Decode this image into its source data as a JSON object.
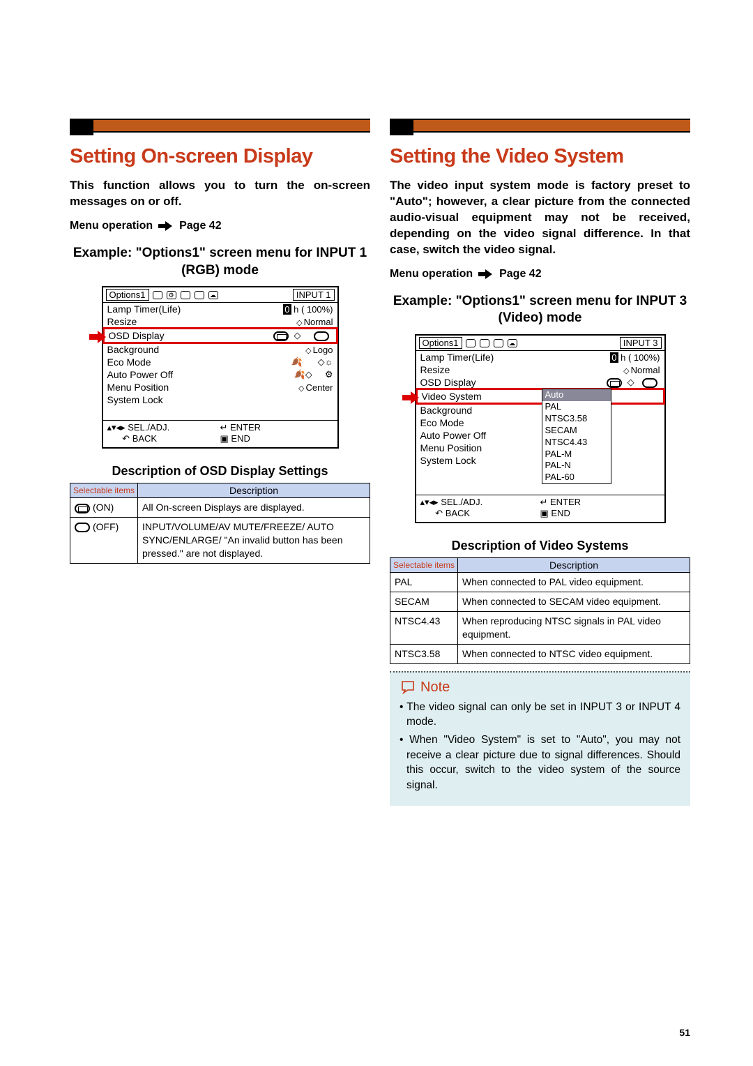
{
  "page_number": "51",
  "left": {
    "top_bar": true,
    "heading": "Setting On-screen Display",
    "lead": "This function allows you to turn the on-screen messages on or off.",
    "menu_op_label": "Menu operation",
    "menu_op_page": "Page 42",
    "example_heading": "Example: \"Options1\" screen menu for INPUT 1 (RGB) mode",
    "osd": {
      "title": "Options1",
      "input": "INPUT 1",
      "lamp_label": "Lamp Timer(Life)",
      "lamp_val": "0 h ( 100%)",
      "rows": [
        {
          "lbl": "Resize",
          "val": "Normal"
        },
        {
          "lbl": "OSD Display",
          "val": ""
        },
        {
          "lbl": "Background",
          "val": "Logo"
        },
        {
          "lbl": "Eco Mode",
          "val": ""
        },
        {
          "lbl": "Auto Power Off",
          "val": ""
        },
        {
          "lbl": "Menu Position",
          "val": "Center"
        },
        {
          "lbl": "System Lock",
          "val": ""
        }
      ],
      "foot": {
        "sel": "SEL./ADJ.",
        "enter": "ENTER",
        "back": "BACK",
        "end": "END"
      }
    },
    "desc_heading": "Description of OSD Display Settings",
    "table": {
      "h1": "Selectable items",
      "h2": "Description",
      "rows": [
        {
          "item": "(ON)",
          "desc": "All On-screen Displays are displayed."
        },
        {
          "item": "(OFF)",
          "desc": "INPUT/VOLUME/AV MUTE/FREEZE/ AUTO SYNC/ENLARGE/ \"An invalid button has been pressed.\" are not displayed."
        }
      ]
    }
  },
  "right": {
    "heading": "Setting the Video System",
    "lead": "The video input system mode is factory preset to \"Auto\"; however, a clear picture from the connected audio-visual equipment may not be received, depending on the video signal difference. In that case, switch the video signal.",
    "menu_op_label": "Menu operation",
    "menu_op_page": "Page 42",
    "example_heading": "Example: \"Options1\" screen menu for INPUT 3 (Video) mode",
    "osd": {
      "title": "Options1",
      "input": "INPUT 3",
      "lamp_label": "Lamp Timer(Life)",
      "lamp_val": "0 h ( 100%)",
      "rows": [
        {
          "lbl": "Resize",
          "val": "Normal"
        },
        {
          "lbl": "OSD Display",
          "val": ""
        },
        {
          "lbl": "Video System",
          "val": "Auto"
        },
        {
          "lbl": "Background",
          "val": ""
        },
        {
          "lbl": "Eco Mode",
          "val": ""
        },
        {
          "lbl": "Auto Power Off",
          "val": ""
        },
        {
          "lbl": "Menu Position",
          "val": ""
        },
        {
          "lbl": "System Lock",
          "val": ""
        }
      ],
      "systems": [
        "Auto",
        "PAL",
        "NTSC3.58",
        "SECAM",
        "NTSC4.43",
        "PAL-M",
        "PAL-N",
        "PAL-60"
      ],
      "foot": {
        "sel": "SEL./ADJ.",
        "enter": "ENTER",
        "back": "BACK",
        "end": "END"
      }
    },
    "desc_heading": "Description of Video Systems",
    "table": {
      "h1": "Selectable items",
      "h2": "Description",
      "rows": [
        {
          "item": "PAL",
          "desc": "When connected to PAL video equipment."
        },
        {
          "item": "SECAM",
          "desc": "When connected to SECAM video equipment."
        },
        {
          "item": "NTSC4.43",
          "desc": "When reproducing NTSC signals in PAL video equipment."
        },
        {
          "item": "NTSC3.58",
          "desc": "When connected to NTSC video equipment."
        }
      ]
    },
    "note": {
      "label": "Note",
      "items": [
        "The video signal can only be set in INPUT 3 or INPUT 4 mode.",
        "When \"Video System\" is set to \"Auto\", you may not receive a clear picture due to signal differences. Should this occur, switch to the video system of the source signal."
      ]
    }
  }
}
